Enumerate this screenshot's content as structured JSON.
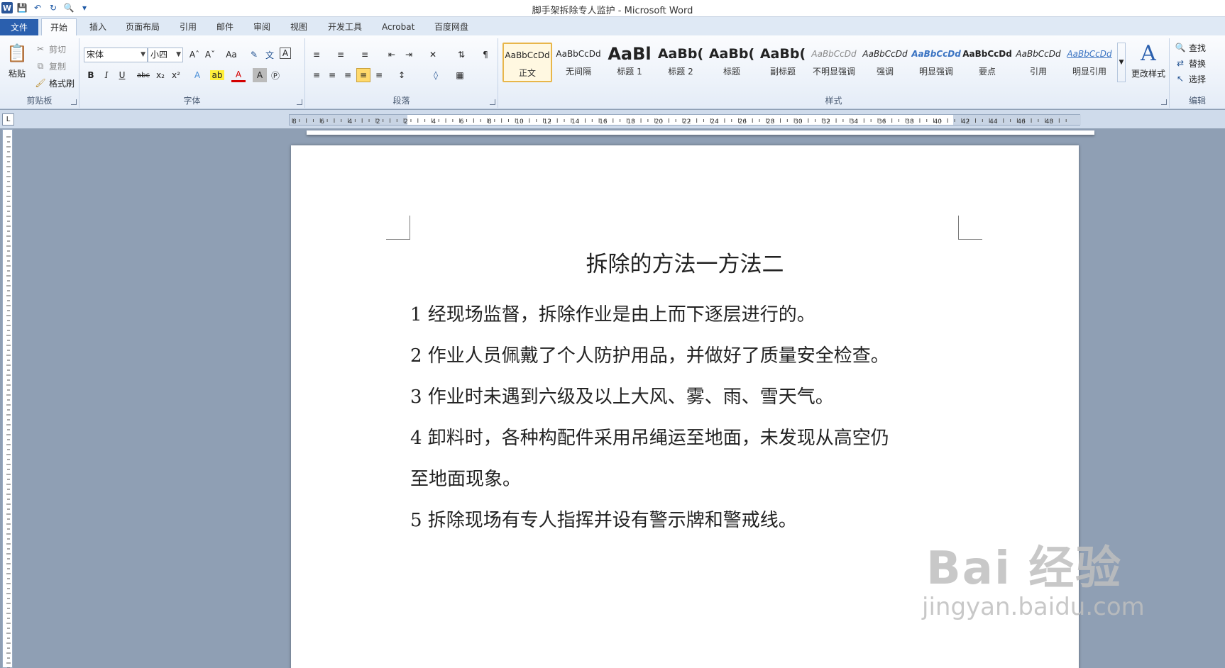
{
  "window": {
    "title": "脚手架拆除专人监护 - Microsoft Word"
  },
  "ribbon_tabs": [
    "文件",
    "开始",
    "插入",
    "页面布局",
    "引用",
    "邮件",
    "审阅",
    "视图",
    "开发工具",
    "Acrobat",
    "百度网盘"
  ],
  "clipboard": {
    "paste": "粘贴",
    "cut": "剪切",
    "copy": "复制",
    "format_painter": "格式刷",
    "label": "剪贴板"
  },
  "font": {
    "name": "宋体",
    "size": "小四",
    "label": "字体"
  },
  "paragraph": {
    "label": "段落"
  },
  "styles": {
    "label": "样式",
    "items": [
      {
        "sample": "AaBbCcDd",
        "name": "正文"
      },
      {
        "sample": "AaBbCcDd",
        "name": "无间隔"
      },
      {
        "sample": "AaBl",
        "name": "标题 1"
      },
      {
        "sample": "AaBb(",
        "name": "标题 2"
      },
      {
        "sample": "AaBb(",
        "name": "标题"
      },
      {
        "sample": "AaBb(",
        "name": "副标题"
      },
      {
        "sample": "AaBbCcDd",
        "name": "不明显强调"
      },
      {
        "sample": "AaBbCcDd",
        "name": "强调"
      },
      {
        "sample": "AaBbCcDd",
        "name": "明显强调"
      },
      {
        "sample": "AaBbCcDd",
        "name": "要点"
      },
      {
        "sample": "AaBbCcDd",
        "name": "引用"
      },
      {
        "sample": "AaBbCcDd",
        "name": "明显引用"
      }
    ],
    "change_styles": "更改样式"
  },
  "editing": {
    "find": "查找",
    "replace": "替换",
    "select": "选择",
    "label": "编辑"
  },
  "ruler": {
    "numbers": [
      "8",
      "6",
      "4",
      "2",
      "2",
      "4",
      "6",
      "8",
      "10",
      "12",
      "14",
      "16",
      "18",
      "20",
      "22",
      "24",
      "26",
      "28",
      "30",
      "32",
      "34",
      "36",
      "38",
      "40",
      "42",
      "44",
      "46",
      "48"
    ]
  },
  "document": {
    "title": "拆除的方法一方法二",
    "paragraphs": [
      "1 经现场监督，拆除作业是由上而下逐层进行的。",
      "2 作业人员佩戴了个人防护用品，并做好了质量安全检查。",
      "3 作业时未遇到六级及以上大风、雾、雨、雪天气。",
      "4  卸料时，各种构配件采用吊绳运至地面，未发现从高空仍",
      "至地面现象。",
      "5 拆除现场有专人指挥并设有警示牌和警戒线。"
    ]
  },
  "watermark": {
    "main": "Bai 经验",
    "sub": "jingyan.baidu.com"
  }
}
